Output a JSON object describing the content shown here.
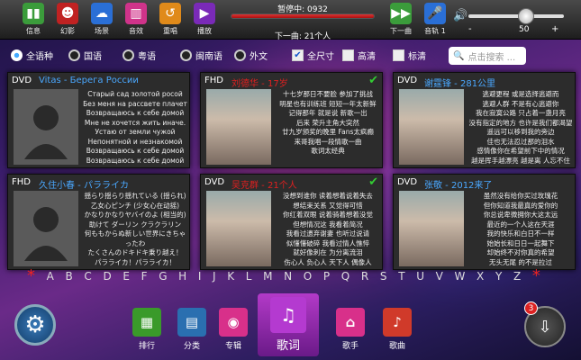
{
  "toolbar": {
    "items": [
      {
        "label": "信息",
        "color": "#3b9c3b",
        "glyph": "▮▮"
      },
      {
        "label": "幻影",
        "color": "#c02222",
        "glyph": "☻"
      },
      {
        "label": "场景",
        "color": "#2a6fd6",
        "glyph": "☁"
      },
      {
        "label": "音效",
        "color": "#d0338a",
        "glyph": "▥"
      },
      {
        "label": "重唱",
        "color": "#e08a1a",
        "glyph": "↺"
      },
      {
        "label": "播放",
        "color": "#7a2ab8",
        "glyph": "▶"
      }
    ],
    "now_playing": "暂停中: 0932",
    "next_song": "下一曲: 21个人",
    "progress": 1.0,
    "next_label": "下一曲",
    "track_label": "音轨 1",
    "volume_minus": "-",
    "volume_value": "50",
    "volume_plus": "+",
    "volume_fraction": 0.6
  },
  "filters": {
    "languages": [
      {
        "label": "全语种",
        "selected": true
      },
      {
        "label": "国语",
        "selected": false
      },
      {
        "label": "粤语",
        "selected": false
      },
      {
        "label": "闽南语",
        "selected": false
      },
      {
        "label": "外文",
        "selected": false
      }
    ],
    "sizes": [
      {
        "label": "全尺寸",
        "checked": true
      },
      {
        "label": "高清",
        "checked": false
      },
      {
        "label": "标清",
        "checked": false
      }
    ],
    "search_placeholder": "点击搜索 ..."
  },
  "cards": [
    {
      "format": "DVD",
      "title": "Vitas - Берега России",
      "title_color": "#4aa8ff",
      "lyrics": "Старый сад золотой росой\nБез меня на рассвете плачет\nВозвращаюсь к себе домой\nМне не хочется жить иначе.\nУстаю от земли чужой\nНепонятной и незнакомой\nВозвращаюсь к себе домой\nВозвращаюсь к себе домой",
      "has_photo": false,
      "checked": false
    },
    {
      "format": "FHD",
      "title": "刘德华 - 17岁",
      "title_color": "#e02020",
      "lyrics": "十七岁那日不要脸 参加了挑战\n明星也有训练班 短短一年太新鲜\n记得那年 就是说 新歌一出\n后来 荣升主角大突然\n廿九岁颁奖的晚里 Fans太疯癫\n来哥我唱一段情歌一曲\n歌词太经典",
      "has_photo": true,
      "checked": true
    },
    {
      "format": "DVD",
      "title": "谢霆锋 - 281公里",
      "title_color": "#4aa8ff",
      "lyrics": "逃避更程 或是选择逃避而\n逃避人群 不是有心逃避你\n我在寂寞公路 只占着一盏月亮\n没有指定的地方 也许是我们都渴望\n遥远可以移到我的旁边\n佳也无法忍过那的泪水\n感情像你在希望前下中的情况\n越是挥手越漂亮 越是离 人忘不住",
      "has_photo": true,
      "checked": false
    },
    {
      "format": "FHD",
      "title": "久住小春 - パラライカ",
      "title_color": "#4aa8ff",
      "lyrics": "揺らり揺らり揺れている (揺られ)\n乙女心ピンチ (少女心在动摇)\nかなりかなりヤバイのよ (相当的)\n助けて ダーリン クラクラリン\n何ももからぬ新しい世界にきちゃったわ\nたくさんのドキドキ乗り越え！\nパラライカ！パラライカ！",
      "has_photo": false,
      "checked": false
    },
    {
      "format": "DVD",
      "title": "吴克群 - 21个人",
      "title_color": "#e02020",
      "lyrics": "没想到谁你 读着想着说着失去\n想结束关系 又觉得可惜\n你红着双眼 说着骑着想着没觉\n但想情况这 我看着简况\n我看过遗弃谢妻 也听过说请\n似懂懂破碎 我看过情人憔悴\n就好像刺在 为分离流泪\n伤心人 负心人 天下人 偶像人",
      "has_photo": true,
      "checked": true
    },
    {
      "format": "DVD",
      "title": "张敬 - 2012来了",
      "title_color": "#4aa8ff",
      "lyrics": "虽然没有给你买过玫瑰花\n但你知道我最真的爱你的\n你总说卑微拥你大这太远\n最近的一个人这在天涯\n我的快乐和白日不一样\n始始长和日日一起舞下\n却始终不对你真的希望\n无头无尾 的不是拉过\n过去的就让它过去吧",
      "has_photo": true,
      "checked": false
    }
  ],
  "alphabet": [
    "*",
    "A",
    "B",
    "C",
    "D",
    "E",
    "F",
    "G",
    "H",
    "I",
    "J",
    "K",
    "L",
    "M",
    "N",
    "O",
    "P",
    "Q",
    "R",
    "S",
    "T",
    "U",
    "V",
    "W",
    "X",
    "Y",
    "Z",
    "*"
  ],
  "dock": [
    {
      "label": "排行",
      "color": "#3a9a2a",
      "glyph": "▦"
    },
    {
      "label": "分类",
      "color": "#2a6fb0",
      "glyph": "▤"
    },
    {
      "label": "专辑",
      "color": "#d8308a",
      "glyph": "◉"
    },
    {
      "label": "歌词",
      "color": "#b43ad0",
      "glyph": "♫"
    },
    {
      "label": "歌手",
      "color": "#d8308a",
      "glyph": "⌂"
    },
    {
      "label": "歌曲",
      "color": "#d03a2a",
      "glyph": "♪"
    }
  ],
  "badge_count": "3"
}
